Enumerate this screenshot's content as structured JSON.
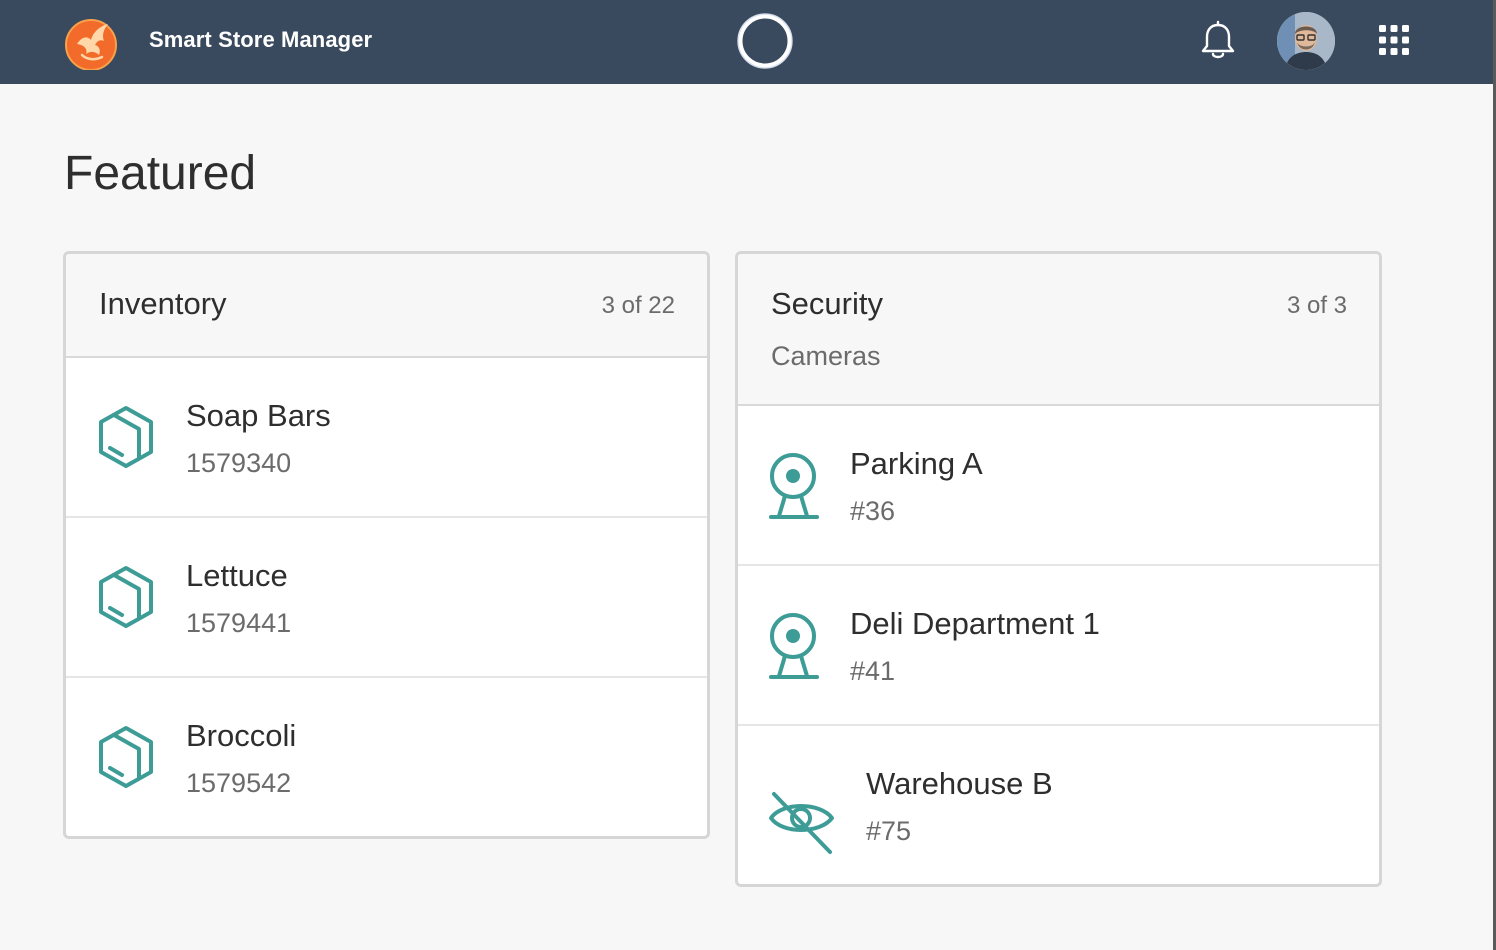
{
  "header": {
    "app_title": "Smart Store Manager",
    "icons": [
      "phoenix-logo-icon",
      "assistant-ring-icon",
      "bell-icon",
      "user-avatar",
      "app-grid-icon"
    ],
    "background_color": "#3a4a5e"
  },
  "page": {
    "title": "Featured"
  },
  "inventory": {
    "title": "Inventory",
    "count": "3 of 22",
    "item_icon": "box-icon",
    "items": [
      {
        "name": "Soap Bars",
        "sku": "1579340"
      },
      {
        "name": "Lettuce",
        "sku": "1579441"
      },
      {
        "name": "Broccoli",
        "sku": "1579542"
      }
    ]
  },
  "security": {
    "title": "Security",
    "subtitle": "Cameras",
    "count": "3 of 3",
    "cameras": [
      {
        "name": "Parking A",
        "id": "#36",
        "icon": "webcam-icon"
      },
      {
        "name": "Deli Department 1",
        "id": "#41",
        "icon": "webcam-icon"
      },
      {
        "name": "Warehouse B",
        "id": "#75",
        "icon": "eye-off-icon"
      }
    ]
  },
  "colors": {
    "accent": "#3e9c97",
    "text_primary": "#2e2e2e",
    "text_secondary": "#6b6b6b"
  }
}
